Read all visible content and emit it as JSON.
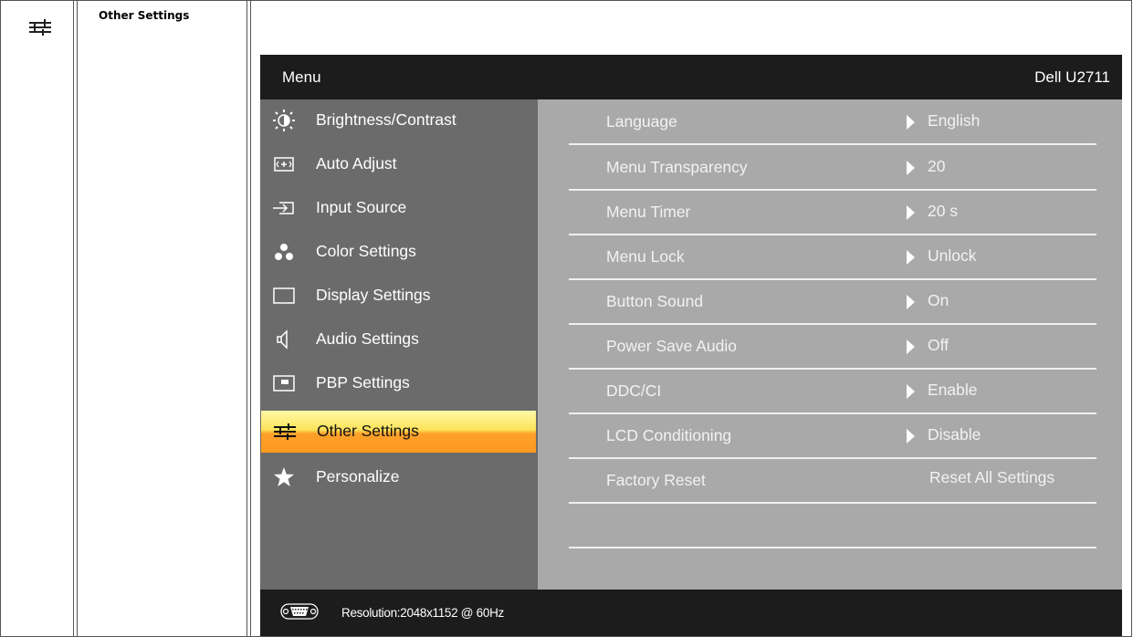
{
  "section": {
    "icon": "sliders-icon",
    "title": "Other Settings"
  },
  "osd": {
    "header": {
      "title": "Menu",
      "model": "Dell U2711"
    },
    "menu": [
      {
        "label": "Brightness/Contrast",
        "icon": "brightness-icon"
      },
      {
        "label": "Auto Adjust",
        "icon": "auto-adjust-icon"
      },
      {
        "label": "Input Source",
        "icon": "input-source-icon"
      },
      {
        "label": "Color Settings",
        "icon": "color-settings-icon"
      },
      {
        "label": "Display Settings",
        "icon": "display-settings-icon"
      },
      {
        "label": "Audio Settings",
        "icon": "speaker-icon"
      },
      {
        "label": "PBP Settings",
        "icon": "pbp-icon"
      },
      {
        "label": "Other Settings",
        "icon": "sliders-icon",
        "selected": true
      },
      {
        "label": "Personalize",
        "icon": "star-icon"
      }
    ],
    "settings": [
      {
        "label": "Language",
        "value": "English"
      },
      {
        "label": "Menu Transparency",
        "value": "20"
      },
      {
        "label": "Menu Timer",
        "value": "20 s"
      },
      {
        "label": "Menu Lock",
        "value": "Unlock"
      },
      {
        "label": "Button Sound",
        "value": "On"
      },
      {
        "label": "Power Save Audio",
        "value": "Off"
      },
      {
        "label": "DDC/CI",
        "value": "Enable"
      },
      {
        "label": "LCD Conditioning",
        "value": "Disable"
      },
      {
        "label": "Factory Reset",
        "value": "Reset All Settings"
      }
    ],
    "footer": {
      "connector_icon": "vga-connector-icon",
      "resolution": "Resolution:2048x1152 @ 60Hz"
    }
  },
  "colors": {
    "selected_top": "#fde45a",
    "selected_bottom": "#fd9a20",
    "header_bg": "#1c1c1c",
    "panel_bg": "#a9a9a9"
  }
}
